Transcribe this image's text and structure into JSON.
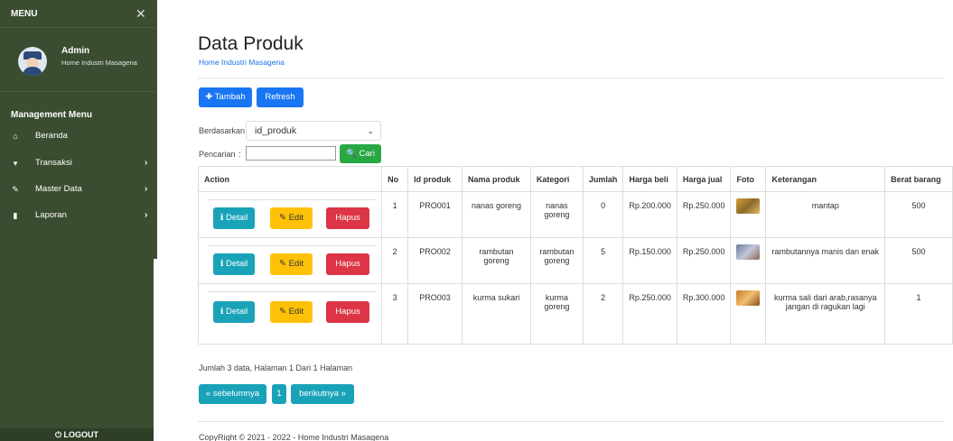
{
  "sidebar": {
    "menu_title": "MENU",
    "close_glyph": "✕",
    "user": {
      "name": "Admin",
      "subtitle": "Home Industri Masagena"
    },
    "section_title": "Management Menu",
    "items": [
      {
        "label": "Beranda",
        "icon": "home-icon",
        "glyph": "⌂",
        "chevron": ""
      },
      {
        "label": "Transaksi",
        "icon": "cart-icon",
        "glyph": "▾",
        "chevron": "›"
      },
      {
        "label": "Master Data",
        "icon": "edit-icon",
        "glyph": "✎",
        "chevron": "›"
      },
      {
        "label": "Laporan",
        "icon": "file-icon",
        "glyph": "▮",
        "chevron": "›"
      }
    ],
    "logout": "⏻ LOGOUT"
  },
  "header": {
    "title": "Data Produk",
    "subtitle": "Home Industri Masagena"
  },
  "toolbar": {
    "add_label": "✚ Tambah",
    "refresh_label": "Refresh"
  },
  "filter": {
    "by_label": "Berdasarkan :",
    "by_value": "id_produk",
    "search_label": "Pencarian",
    "search_separator": ":",
    "search_value": "",
    "search_button": "🔍 Cari"
  },
  "table": {
    "columns": [
      "Action",
      "No",
      "Id produk",
      "Nama produk",
      "Kategori",
      "Jumlah",
      "Harga beli",
      "Harga jual",
      "Foto",
      "Keterangan",
      "Berat barang"
    ],
    "action_labels": {
      "detail": "ℹ Detail",
      "edit": "✎ Edit",
      "delete": "Hapus"
    },
    "rows": [
      {
        "no": "1",
        "id": "PRO001",
        "nama": "nanas goreng",
        "kategori": "nanas goreng",
        "jumlah": "0",
        "harga_beli": "Rp.200.000",
        "harga_jual": "Rp.250.000",
        "foto": "product-photo-icon",
        "keterangan": "mantap",
        "berat": "500"
      },
      {
        "no": "2",
        "id": "PRO002",
        "nama": "rambutan goreng",
        "kategori": "rambutan goreng",
        "jumlah": "5",
        "harga_beli": "Rp.150.000",
        "harga_jual": "Rp.250.000",
        "foto": "product-photo-icon",
        "keterangan": "rambutannya manis dan enak",
        "berat": "500"
      },
      {
        "no": "3",
        "id": "PRO003",
        "nama": "kurma sukari",
        "kategori": "kurma goreng",
        "jumlah": "2",
        "harga_beli": "Rp.250.000",
        "harga_jual": "Rp.300.000",
        "foto": "product-photo-icon",
        "keterangan": "kurma sali dari arab,rasanya jangan di ragukan lagi",
        "berat": "1"
      }
    ]
  },
  "summary": "Jumlah 3 data, Halaman 1 Dari 1 Halaman",
  "pagination": {
    "prev": "« sebelumnya",
    "page": "1",
    "next": "berikutnya »"
  },
  "footer": "CopyRight © 2021 - 2022 - Home Industri Masagena",
  "colors": {
    "sidebar": "#3b4d30",
    "primary": "#1976f2",
    "success": "#28a745",
    "info": "#1aa3b8",
    "warning": "#ffc107",
    "danger": "#dc3545"
  }
}
